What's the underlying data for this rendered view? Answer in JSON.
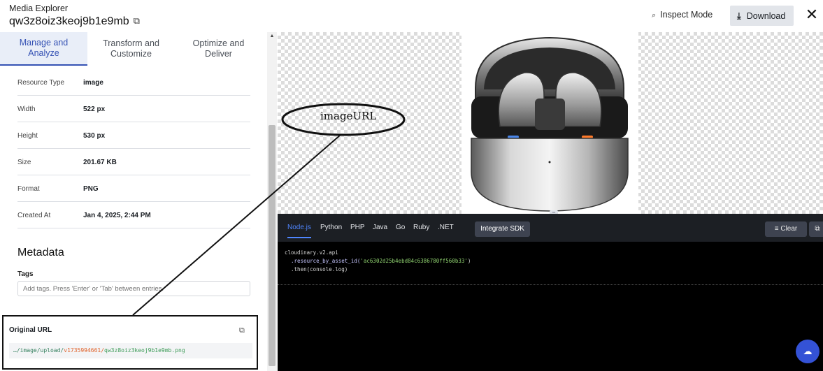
{
  "header": {
    "app_title": "Media Explorer",
    "asset_name": "qw3z8oiz3keoj9b1e9mb",
    "inspect_label": "Inspect Mode",
    "download_label": "Download",
    "close_glyph": "✕"
  },
  "tabs": [
    {
      "label": "Manage and\nAnalyze",
      "active": true
    },
    {
      "label": "Transform and\nCustomize",
      "active": false
    },
    {
      "label": "Optimize and\nDeliver",
      "active": false
    }
  ],
  "properties": [
    {
      "key": "Resource Type",
      "value": "image"
    },
    {
      "key": "Width",
      "value": "522 px"
    },
    {
      "key": "Height",
      "value": "530 px"
    },
    {
      "key": "Size",
      "value": "201.67 KB"
    },
    {
      "key": "Format",
      "value": "PNG"
    },
    {
      "key": "Created At",
      "value": "Jan 4, 2025, 2:44 PM"
    }
  ],
  "metadata": {
    "title": "Metadata",
    "tags_label": "Tags",
    "tags_placeholder": "Add tags. Press 'Enter' or 'Tab' between entries."
  },
  "original_url": {
    "label": "Original URL",
    "prefix": "…/image/upload/",
    "version": "v1735994661/",
    "file": "qw3z8oiz3keoj9b1e9mb.png"
  },
  "annotation": {
    "label": "imageURL"
  },
  "code_panel": {
    "languages": [
      "Node.js",
      "Python",
      "PHP",
      "Java",
      "Go",
      "Ruby",
      ".NET"
    ],
    "active_language": "Node.js",
    "integrate_label": "Integrate SDK",
    "clear_label": "Clear",
    "code_line1": "cloudinary.v2.api",
    "code_line2_fn": "  .resource_by_asset_id(",
    "code_line2_str": "'ac6302d25b4ebd84c6386780ff560b33'",
    "code_line2_end": ")",
    "code_line3": "  .then(console.log)"
  },
  "colors": {
    "accent": "#3552b4",
    "code_bg": "#000000",
    "url_version": "#e0622a",
    "url_file": "#3a9a55"
  }
}
